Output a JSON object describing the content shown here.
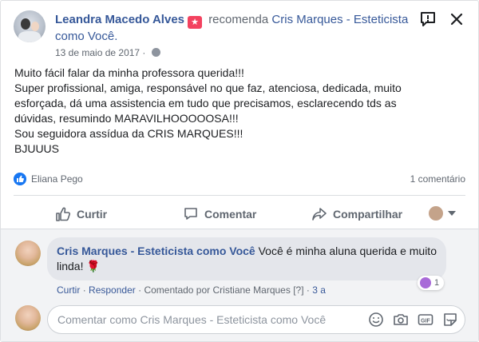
{
  "post": {
    "author": "Leandra Macedo Alves",
    "recommends_text": "recomenda",
    "page_name_line1": "Cris Marques - Esteticista",
    "page_name_line2": "como Você.",
    "date": "13 de maio de 2017",
    "body_lines": [
      "Muito fácil falar da minha professora querida!!!",
      "Super profissional, amiga, responsável no que faz, atenciosa, dedicada, muito",
      "esforçada, dá uma assistencia em tudo que precisamos, esclarecendo tds as",
      "dúvidas, resumindo MARAVILHOOOOOSA!!!",
      "Sou seguidora assídua da CRIS MARQUES!!!",
      "BJUUUS"
    ],
    "liker": "Eliana Pego",
    "comment_count": "1 comentário"
  },
  "actions": {
    "like": "Curtir",
    "comment": "Comentar",
    "share": "Compartilhar"
  },
  "comment": {
    "author": "Cris Marques - Esteticista como Você",
    "text_line1": "Você é minha aluna querida e muito",
    "text_line2": "linda!",
    "emoji": "🌹",
    "reaction_count": "1",
    "like_link": "Curtir",
    "reply_link": "Responder",
    "commented_by": "Comentado por Cristiane Marques",
    "help_mark": "[?]",
    "time": "3 a",
    "sep": "·"
  },
  "composer": {
    "placeholder": "Comentar como Cris Marques - Esteticista como Você"
  },
  "colors": {
    "link_blue": "#365899",
    "like_blue": "#1877f2",
    "badge_red": "#f3425f"
  },
  "icons": [
    "report-icon",
    "close-icon",
    "globe-icon",
    "like-reaction-icon",
    "thumbs-up-icon",
    "comment-icon",
    "share-icon",
    "caret-down-icon",
    "emoji-icon",
    "camera-icon",
    "gif-icon",
    "sticker-icon"
  ]
}
